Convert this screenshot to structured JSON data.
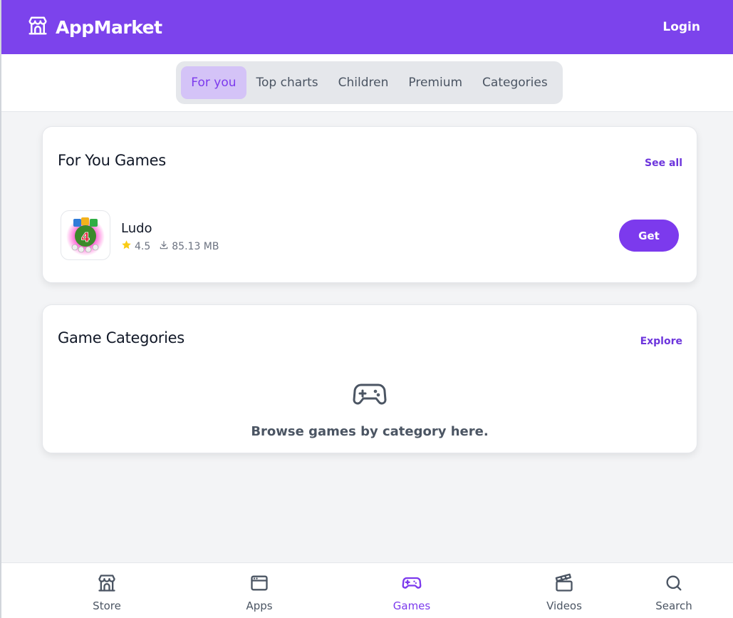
{
  "header": {
    "brand_icon": "store-icon",
    "brand": "AppMarket",
    "login": "Login",
    "accent": "#7c43ec"
  },
  "tabs": [
    {
      "label": "For you",
      "active": true
    },
    {
      "label": "Top charts",
      "active": false
    },
    {
      "label": "Children",
      "active": false
    },
    {
      "label": "Premium",
      "active": false
    },
    {
      "label": "Categories",
      "active": false
    }
  ],
  "for_you": {
    "title": "For You Games",
    "link": "See all",
    "app": {
      "name": "Ludo",
      "rating": "4.5",
      "rating_icon": "star-icon",
      "size_icon": "download-icon",
      "size": "85.13 MB",
      "action": "Get"
    }
  },
  "categories": {
    "title": "Game Categories",
    "link": "Explore",
    "empty_icon": "gamepad-icon",
    "empty_text": "Browse games by category here."
  },
  "bottom_nav": [
    {
      "label": "Store",
      "icon": "store-icon",
      "active": false
    },
    {
      "label": "Apps",
      "icon": "browser-window-icon",
      "active": false
    },
    {
      "label": "Games",
      "icon": "gamepad-icon",
      "active": true
    },
    {
      "label": "Videos",
      "icon": "clapperboard-icon",
      "active": false
    },
    {
      "label": "Search",
      "icon": "search-icon",
      "active": false
    }
  ]
}
